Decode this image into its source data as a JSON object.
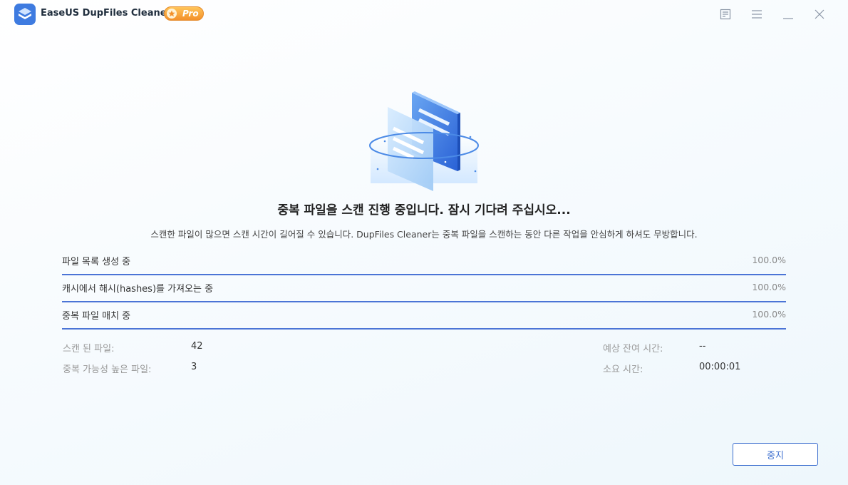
{
  "app": {
    "title": "EaseUS DupFiles Cleaner",
    "badge": "Pro",
    "accent_color": "#3d6fcf",
    "badge_color": "#f3902a"
  },
  "window_controls": {
    "icons": [
      "feedback-icon",
      "menu-icon",
      "minimize-icon",
      "close-icon"
    ]
  },
  "scan": {
    "heading": "중복 파일을 스캔 진행 중입니다. 잠시 기다려 주십시오...",
    "subtext": "스캔한 파일이 많으면 스캔 시간이 길어질 수 있습니다. DupFiles Cleaner는 중복 파일을 스캔하는 동안 다른 작업을 안심하게 하셔도 무방합니다.",
    "steps": [
      {
        "label": "파일 목록 생성 중",
        "percent_text": "100.0%",
        "progress": 1.0
      },
      {
        "label": "캐시에서 해시(hashes)를 가져오는 중",
        "percent_text": "100.0%",
        "progress": 1.0
      },
      {
        "label": "중복 파일 매치 중",
        "percent_text": "100.0%",
        "progress": 1.0
      }
    ]
  },
  "stats": {
    "scanned_label": "스캔 된 파일:",
    "scanned_value": "42",
    "dup_label": "중복 가능성 높은 파일:",
    "dup_value": "3",
    "remaining_label": "예상 잔여 시간:",
    "remaining_value": "--",
    "elapsed_label": "소요 시간:",
    "elapsed_value": "00:00:01"
  },
  "actions": {
    "stop_label": "중지"
  }
}
